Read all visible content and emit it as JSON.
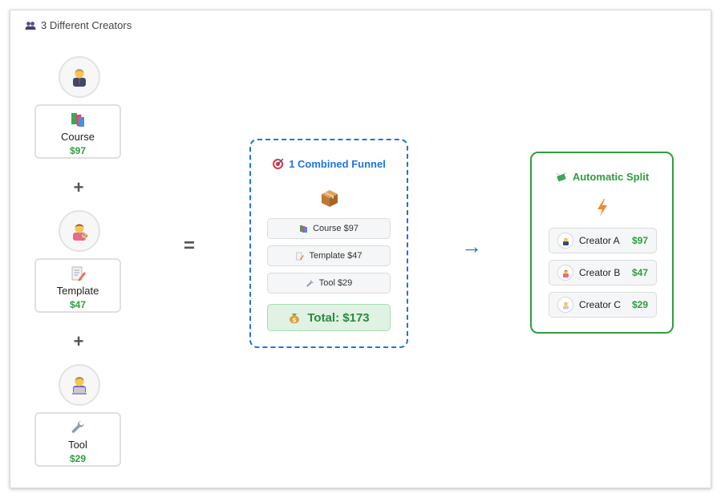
{
  "header": {
    "title": "3 Different Creators",
    "icon": "people-icon"
  },
  "creators": [
    {
      "avatar_icon": "businessman-icon",
      "product_icon": "books-icon",
      "product": "Course",
      "price": "$97"
    },
    {
      "avatar_icon": "artist-icon",
      "product_icon": "memo-icon",
      "product": "Template",
      "price": "$47"
    },
    {
      "avatar_icon": "technologist-icon",
      "product_icon": "wrench-icon",
      "product": "Tool",
      "price": "$29"
    }
  ],
  "operators": {
    "plus": "+",
    "equals": "=",
    "arrow": "→"
  },
  "funnel": {
    "title": "1 Combined Funnel",
    "title_icon": "target-icon",
    "box_icon": "package-icon",
    "items": [
      "Course $97",
      "Template $47",
      "Tool $29"
    ],
    "total": "Total: $173",
    "total_icon": "money-bag-icon"
  },
  "split": {
    "title": "Automatic Split",
    "title_icon": "money-wings-icon",
    "bolt_icon": "lightning-icon",
    "rows": [
      {
        "name": "Creator A",
        "amount": "$97"
      },
      {
        "name": "Creator B",
        "amount": "$47"
      },
      {
        "name": "Creator C",
        "amount": "$29"
      }
    ]
  },
  "colors": {
    "accent_blue": "#1f74e0",
    "accent_green": "#2e9e3e",
    "total_bg": "#dff2e3"
  }
}
